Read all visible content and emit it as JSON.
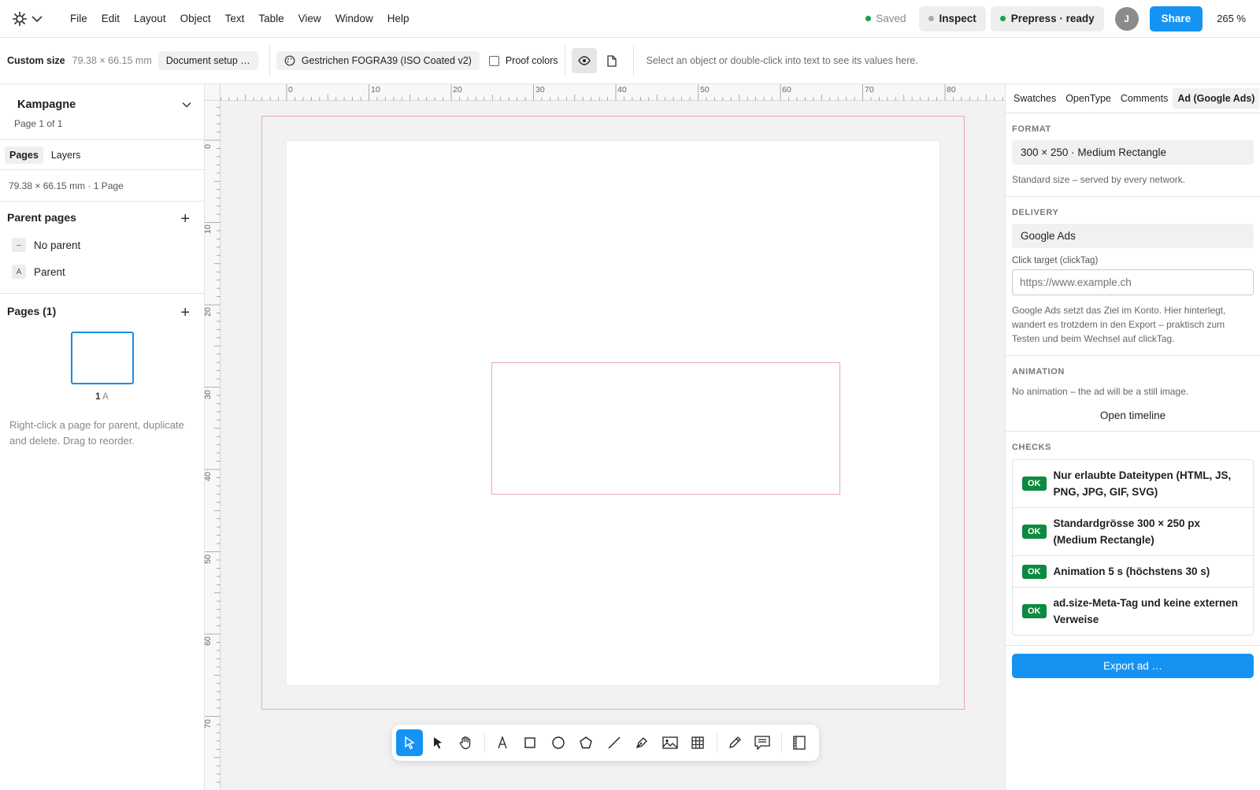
{
  "menubar": {
    "menu_items": [
      "File",
      "Edit",
      "Layout",
      "Object",
      "Text",
      "Table",
      "View",
      "Window",
      "Help"
    ],
    "saved_label": "Saved",
    "inspect_label": "Inspect",
    "prepress_label": "Prepress · ready",
    "avatar_initial": "J",
    "share_label": "Share",
    "zoom": "265 %"
  },
  "toolbar": {
    "size_label": "Custom size",
    "size_value": "79.38 × 66.15 mm",
    "document_setup": "Document setup …",
    "color_profile": "Gestrichen FOGRA39 (ISO Coated v2)",
    "proof_colors": "Proof colors",
    "hint": "Select an object or double-click into text to see its values here."
  },
  "left": {
    "doc_title": "Kampagne",
    "doc_sub": "Page 1 of 1",
    "tabs": [
      "Pages",
      "Layers"
    ],
    "size_line": "79.38 × 66.15 mm  ·  1 Page",
    "parent_title": "Parent pages",
    "parents": [
      {
        "tag": "–",
        "label": "No parent"
      },
      {
        "tag": "A",
        "label": "Parent"
      }
    ],
    "pages_title": "Pages (1)",
    "page_number": "1",
    "page_parent": "A",
    "hint": "Right-click a page for parent, duplicate and delete. Drag to reorder."
  },
  "rulers": {
    "h_ticks": [
      "0",
      "10",
      "20",
      "30",
      "40",
      "50",
      "60",
      "70",
      "80"
    ],
    "v_ticks": [
      "0",
      "10",
      "20",
      "30",
      "40",
      "50",
      "60",
      "70"
    ]
  },
  "right": {
    "tabs": [
      "Swatches",
      "OpenType",
      "Comments",
      "Ad (Google Ads)"
    ],
    "format_title": "FORMAT",
    "format_value": "300 × 250 · Medium Rectangle",
    "format_note": "Standard size – served by every network.",
    "delivery_title": "DELIVERY",
    "delivery_value": "Google Ads",
    "click_label": "Click target (clickTag)",
    "click_placeholder": "https://www.example.ch",
    "delivery_note": "Google Ads setzt das Ziel im Konto. Hier hinterlegt, wandert es trotzdem in den Export – praktisch zum Testen und beim Wechsel auf clickTag.",
    "animation_title": "ANIMATION",
    "animation_note": "No animation – the ad will be a still image.",
    "open_timeline": "Open timeline",
    "checks_title": "CHECKS",
    "checks": [
      {
        "status": "OK",
        "text": "Nur erlaubte Dateitypen (HTML, JS, PNG, JPG, GIF, SVG)"
      },
      {
        "status": "OK",
        "text": "Standardgrösse 300 × 250 px (Medium Rectangle)"
      },
      {
        "status": "OK",
        "text": "Animation 5 s (höchstens 30 s)"
      },
      {
        "status": "OK",
        "text": "ad.size-Meta-Tag und keine externen Verweise"
      }
    ],
    "export_label": "Export ad …"
  },
  "colors": {
    "accent": "#1593f2",
    "ok": "#0c8a3f",
    "saved_dot": "#1e9e4a",
    "bleed": "#e8a9b5"
  }
}
